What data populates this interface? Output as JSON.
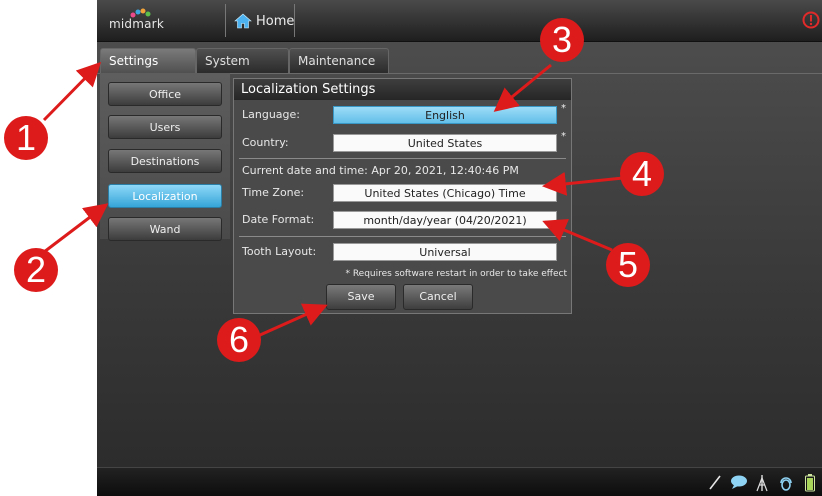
{
  "header": {
    "logo_text": "midmark",
    "home_label": "Home"
  },
  "tabs": [
    {
      "label": "Settings",
      "active": true
    },
    {
      "label": "System",
      "active": false
    },
    {
      "label": "Maintenance",
      "active": false
    }
  ],
  "sidebar": {
    "items": [
      {
        "label": "Office",
        "active": false
      },
      {
        "label": "Users",
        "active": false
      },
      {
        "label": "Destinations",
        "active": false
      },
      {
        "label": "Localization",
        "active": true
      },
      {
        "label": "Wand",
        "active": false
      }
    ]
  },
  "localization": {
    "title": "Localization Settings",
    "language_label": "Language:",
    "language_value": "English",
    "country_label": "Country:",
    "country_value": "United States",
    "required_mark": "*",
    "datetime_text": "Current date and time: Apr 20, 2021, 12:40:46 PM",
    "timezone_label": "Time Zone:",
    "timezone_value": "United States (Chicago) Time",
    "dateformat_label": "Date Format:",
    "dateformat_value": "month/day/year (04/20/2021)",
    "tooth_label": "Tooth Layout:",
    "tooth_value": "Universal",
    "restart_note": "* Requires software restart in order to take effect",
    "save_label": "Save",
    "cancel_label": "Cancel"
  },
  "callouts": [
    "1",
    "2",
    "3",
    "4",
    "5",
    "6"
  ],
  "colors": {
    "accent": "#5cc0ec",
    "callout": "#dd1b1b",
    "alert": "#e02a2a"
  }
}
